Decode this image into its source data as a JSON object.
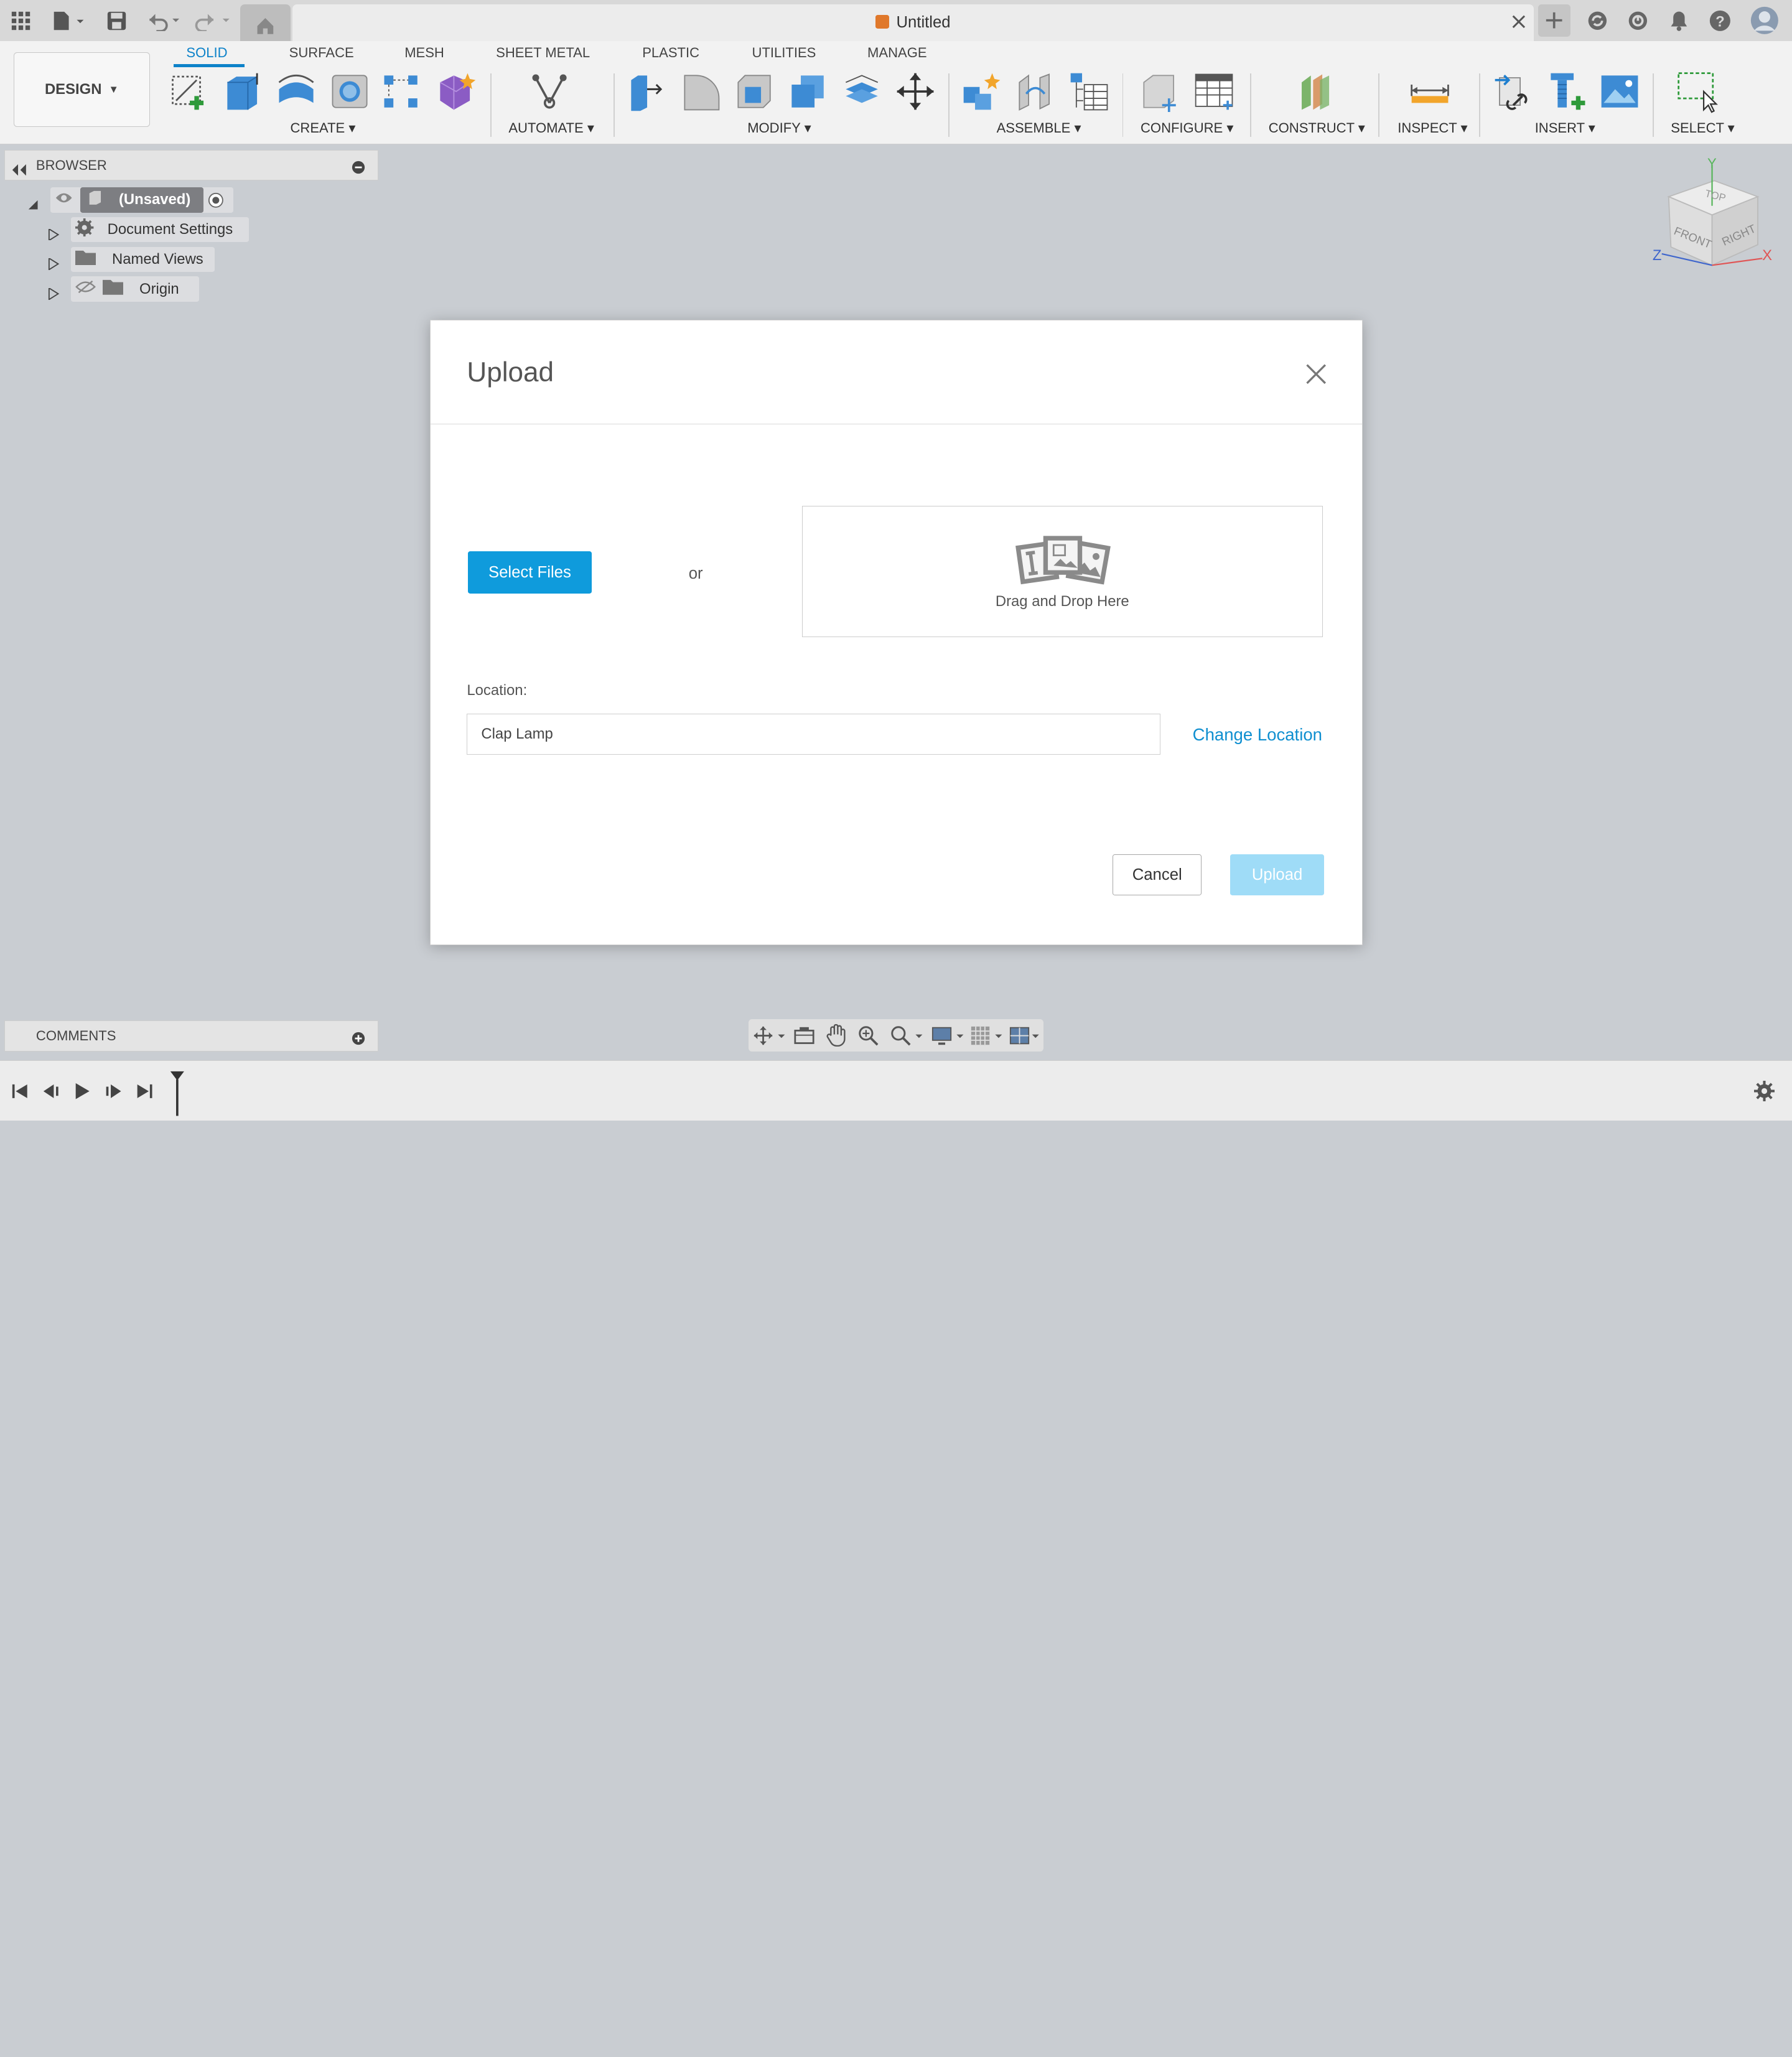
{
  "window": {
    "title": "Untitled"
  },
  "workspace": {
    "label": "DESIGN"
  },
  "tabs": [
    {
      "label": "SOLID",
      "active": true
    },
    {
      "label": "SURFACE"
    },
    {
      "label": "MESH"
    },
    {
      "label": "SHEET METAL"
    },
    {
      "label": "PLASTIC"
    },
    {
      "label": "UTILITIES"
    },
    {
      "label": "MANAGE"
    }
  ],
  "groups": {
    "create": "CREATE ▾",
    "automate": "AUTOMATE ▾",
    "modify": "MODIFY ▾",
    "assemble": "ASSEMBLE ▾",
    "configure": "CONFIGURE ▾",
    "construct": "CONSTRUCT ▾",
    "inspect": "INSPECT ▾",
    "insert": "INSERT ▾",
    "select": "SELECT ▾"
  },
  "browser": {
    "title": "BROWSER",
    "root": "(Unsaved)",
    "items": [
      {
        "label": "Document Settings"
      },
      {
        "label": "Named Views"
      },
      {
        "label": "Origin"
      }
    ]
  },
  "viewcube": {
    "top": "TOP",
    "front": "FRONT",
    "right": "RIGHT",
    "x": "X",
    "y": "Y",
    "z": "Z"
  },
  "comments": {
    "title": "COMMENTS"
  },
  "dialog": {
    "title": "Upload",
    "select_files": "Select Files",
    "or": "or",
    "drop_text": "Drag and Drop Here",
    "location_label": "Location:",
    "location_value": "Clap Lamp",
    "change_location": "Change Location",
    "cancel": "Cancel",
    "upload": "Upload"
  },
  "colors": {
    "accent": "#0f9bdc",
    "tab_active": "#0d82c9",
    "upload_disabled": "#9fdcf7"
  }
}
